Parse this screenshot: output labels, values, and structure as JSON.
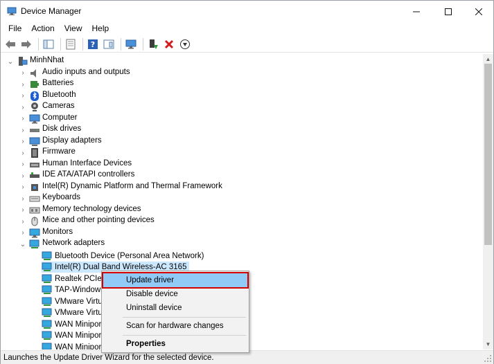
{
  "window": {
    "title": "Device Manager"
  },
  "menu": [
    "File",
    "Action",
    "View",
    "Help"
  ],
  "tree": {
    "root": "MinhNhat",
    "categories": [
      "Audio inputs and outputs",
      "Batteries",
      "Bluetooth",
      "Cameras",
      "Computer",
      "Disk drives",
      "Display adapters",
      "Firmware",
      "Human Interface Devices",
      "IDE ATA/ATAPI controllers",
      "Intel(R) Dynamic Platform and Thermal Framework",
      "Keyboards",
      "Memory technology devices",
      "Mice and other pointing devices",
      "Monitors",
      "Network adapters"
    ],
    "network_children": [
      "Bluetooth Device (Personal Area Network)",
      "Intel(R) Dual Band Wireless-AC 3165",
      "Realtek PCIe G",
      "TAP-Windows A",
      "VMware Virtua",
      "VMware Virtua",
      "WAN Miniport",
      "WAN Miniport",
      "WAN Miniport"
    ]
  },
  "context_menu": {
    "update_driver": "Update driver",
    "disable_device": "Disable device",
    "uninstall_device": "Uninstall device",
    "scan_hardware": "Scan for hardware changes",
    "properties": "Properties"
  },
  "status": {
    "text": "Launches the Update Driver Wizard for the selected device."
  },
  "colors": {
    "selection": "#cce8ff",
    "menu_highlight": "#91c9f7",
    "highlight_border": "#d20000"
  }
}
